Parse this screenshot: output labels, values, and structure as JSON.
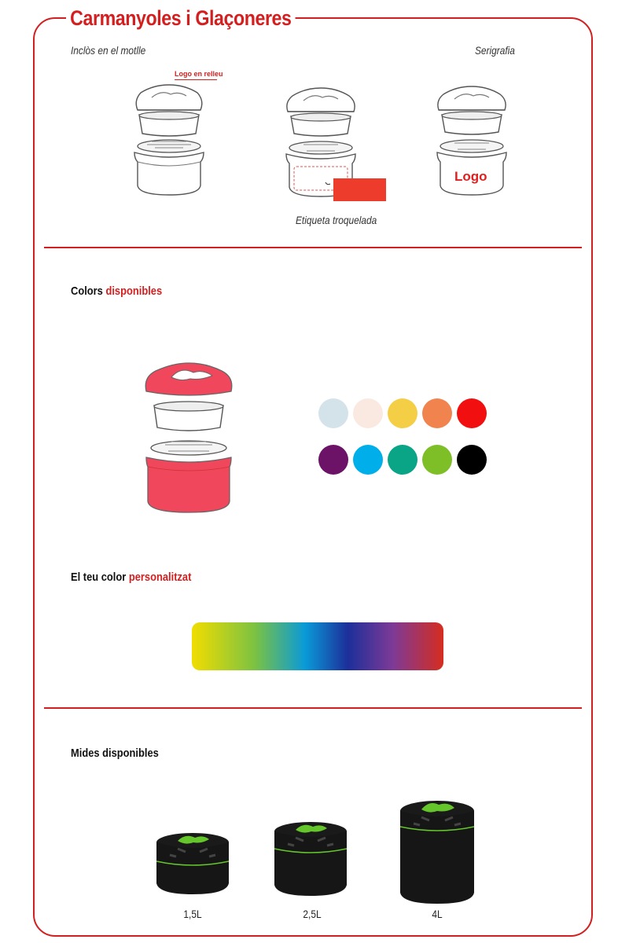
{
  "header": {
    "title": "Carmanyoles i Glaçoneres"
  },
  "customization": {
    "included_label": "Inclòs en el motlle",
    "serigraphy_label": "Serigrafia",
    "embossed_logo_label": "Logo en relleu",
    "diecut_label": "Etiqueta troquelada",
    "logo_text": "Logo"
  },
  "colors_section": {
    "heading_plain": "Colors",
    "heading_accent": "disponibles",
    "swatches": [
      {
        "name": "light-blue",
        "color": "#d4e3ea"
      },
      {
        "name": "cream",
        "color": "#fae9e1"
      },
      {
        "name": "yellow",
        "color": "#f4cf45"
      },
      {
        "name": "orange",
        "color": "#f0834e"
      },
      {
        "name": "red",
        "color": "#f20f0f"
      },
      {
        "name": "purple",
        "color": "#6d1367"
      },
      {
        "name": "cyan",
        "color": "#00aeea"
      },
      {
        "name": "teal",
        "color": "#0aa486"
      },
      {
        "name": "green",
        "color": "#7ebe27"
      },
      {
        "name": "black",
        "color": "#000000"
      }
    ],
    "product_color": "#f0475c"
  },
  "custom_color_section": {
    "heading_plain": "El teu color",
    "heading_accent": "personalitzat"
  },
  "sizes_section": {
    "heading": "Mides disponibles",
    "sizes": [
      {
        "label": "1,5L"
      },
      {
        "label": "2,5L"
      },
      {
        "label": "4L"
      }
    ]
  },
  "accent_color": "#d31f1f"
}
